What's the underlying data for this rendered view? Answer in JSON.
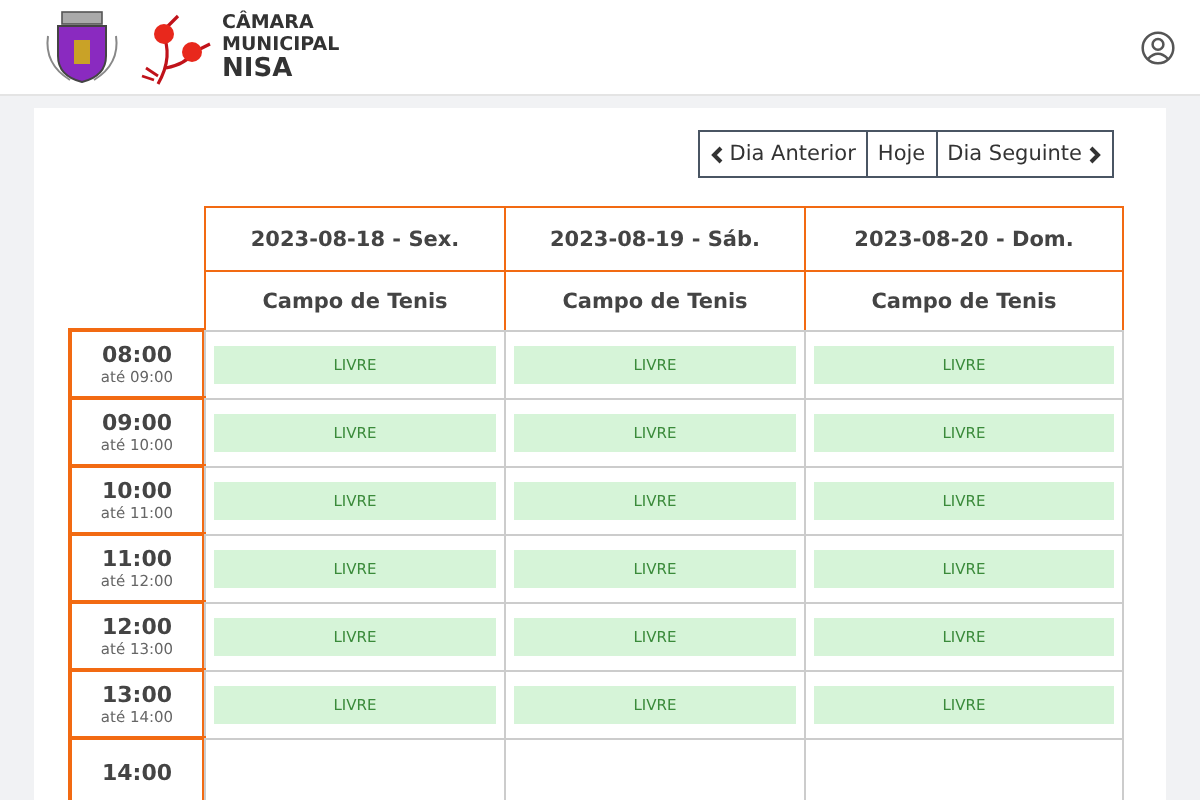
{
  "header": {
    "logo_lines": [
      "CÂMARA",
      "MUNICIPAL",
      "NISA"
    ]
  },
  "nav": {
    "previous": "Dia Anterior",
    "today": "Hoje",
    "next": "Dia Seguinte"
  },
  "days": [
    {
      "date": "2023-08-18 - Sex.",
      "resource": "Campo de Tenis"
    },
    {
      "date": "2023-08-19 - Sáb.",
      "resource": "Campo de Tenis"
    },
    {
      "date": "2023-08-20 - Dom.",
      "resource": "Campo de Tenis"
    }
  ],
  "rows": [
    {
      "time": "08:00",
      "until": "até 09:00",
      "slots": [
        {
          "label": "LIVRE"
        },
        {
          "label": "LIVRE"
        },
        {
          "label": "LIVRE"
        }
      ]
    },
    {
      "time": "09:00",
      "until": "até 10:00",
      "slots": [
        {
          "label": "LIVRE"
        },
        {
          "label": "LIVRE"
        },
        {
          "label": "LIVRE"
        }
      ]
    },
    {
      "time": "10:00",
      "until": "até 11:00",
      "slots": [
        {
          "label": "LIVRE"
        },
        {
          "label": "LIVRE"
        },
        {
          "label": "LIVRE"
        }
      ]
    },
    {
      "time": "11:00",
      "until": "até 12:00",
      "slots": [
        {
          "label": "LIVRE"
        },
        {
          "label": "LIVRE"
        },
        {
          "label": "LIVRE"
        }
      ]
    },
    {
      "time": "12:00",
      "until": "até 13:00",
      "slots": [
        {
          "label": "LIVRE"
        },
        {
          "label": "LIVRE"
        },
        {
          "label": "LIVRE"
        }
      ]
    },
    {
      "time": "13:00",
      "until": "até 14:00",
      "slots": [
        {
          "label": "LIVRE"
        },
        {
          "label": "LIVRE"
        },
        {
          "label": "LIVRE"
        }
      ]
    },
    {
      "time": "14:00"
    }
  ]
}
